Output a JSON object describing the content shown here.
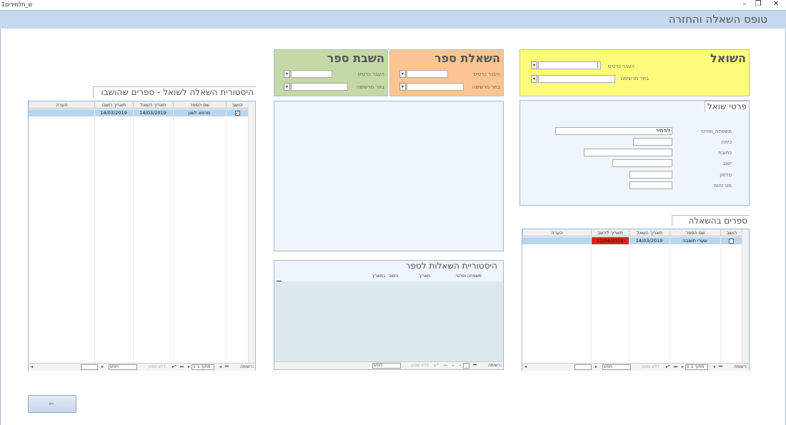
{
  "window": {
    "tab_label": "ש_תלמידים1",
    "minimize": "–",
    "restore": "❐",
    "close": "✕"
  },
  "header": {
    "title": "טופס השאלה והחזרה"
  },
  "borrower": {
    "title": "השואל",
    "scan_card_label": "העבר כרטיס",
    "choose_list_label": "בחר מרשימה",
    "scan_card_value": "|",
    "choose_list_value": ""
  },
  "borrow_book": {
    "title": "השאלת ספר",
    "scan_card_label": "העבר כרטיס",
    "choose_list_label": "בחר מרשימה"
  },
  "return_book": {
    "title": "השבת ספר",
    "scan_card_label": "העבר כרטיס",
    "choose_list_label": "בחר מרשימה"
  },
  "details": {
    "title": "פרטי שואל",
    "fields": [
      {
        "label": "משפחה_ופרטי",
        "value": "לודמיר"
      },
      {
        "label": "כיתה",
        "value": ""
      },
      {
        "label": "כתובת",
        "value": ""
      },
      {
        "label": "ישוב",
        "value": ""
      },
      {
        "label": "טלפון",
        "value": ""
      },
      {
        "label": "מס זהות",
        "value": ""
      }
    ]
  },
  "loans": {
    "title": "ספרים בהשאלה",
    "columns": [
      "הושב",
      "שם הספר",
      "תאריך השאל",
      "תאריך להשב",
      "הערה"
    ],
    "rows": [
      {
        "returned": false,
        "book": "שערי תשובה",
        "loan_date": "14/03/2019",
        "due_date": "13/04/2019",
        "note": ""
      }
    ],
    "due_overdue_color": "#e0201c",
    "nav": {
      "record_label": "רשומה:",
      "first": "⏮",
      "prev": "◂",
      "position": "1 מתוך 1",
      "next": "▸",
      "last": "⏭",
      "new": "▸*",
      "no_filter": "ללא מסנן",
      "search": "חפש"
    }
  },
  "history": {
    "title": "היסטורית השאלה לשואל - ספרים שהושבו",
    "columns": [
      "הושב",
      "שם הספר",
      "תאריך השאל",
      "תאריך השבו",
      "הערה"
    ],
    "rows": [
      {
        "returned": true,
        "book": "מרפא לשון",
        "loan_date": "14/03/2019",
        "return_date": "14/03/2019",
        "note": ""
      }
    ],
    "nav": {
      "record_label": "רשומה:",
      "first": "⏮",
      "prev": "◂",
      "position": "1 מתוך 1",
      "next": "▸",
      "last": "⏭",
      "new": "▸*",
      "no_filter": "ללא מסנן",
      "search": "חפש"
    }
  },
  "book_history": {
    "title": "היסטוריית השאלות לספר",
    "columns": [
      "משפחה ופרטי",
      "תאריך",
      "הושב",
      "בתאריך"
    ],
    "nav": {
      "record_label": "רשומה:",
      "first": "⏮",
      "prev": "◂",
      "next": "▸",
      "last": "⏭",
      "new": "▸*",
      "no_filter": "ללא מסנן",
      "search": "חפש"
    }
  },
  "exit_button": {
    "icon": "exit-door-icon",
    "glyph": "⇦"
  },
  "colors": {
    "header_bg": "#c5d8ee",
    "borrower_bg": "#fdfb7a",
    "borrow_bg": "#fbc591",
    "return_bg": "#c5d9a6",
    "selected_row": "#b7d7f0"
  }
}
